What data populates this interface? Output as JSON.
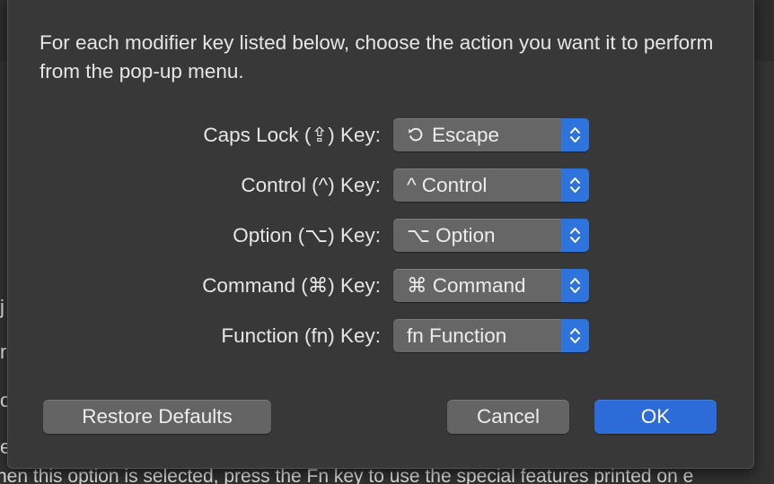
{
  "background": {
    "edge_glyphs": [
      "j",
      "r",
      "o",
      "e"
    ],
    "bottom_text": "hen this option is selected, press the Fn key to use the special features printed on e"
  },
  "dialog": {
    "instruction": "For each modifier key listed below, choose the action you want it to perform from the pop-up menu.",
    "rows": [
      {
        "label": "Caps Lock (⇪) Key:",
        "value": "Escape",
        "value_icon": "escape-icon"
      },
      {
        "label": "Control (^) Key:",
        "value": "^ Control",
        "value_icon": ""
      },
      {
        "label": "Option (⌥) Key:",
        "value": "⌥ Option",
        "value_icon": ""
      },
      {
        "label": "Command (⌘) Key:",
        "value": "⌘ Command",
        "value_icon": ""
      },
      {
        "label": "Function (fn) Key:",
        "value": "fn Function",
        "value_icon": ""
      }
    ],
    "buttons": {
      "restore": "Restore Defaults",
      "cancel": "Cancel",
      "ok": "OK"
    }
  },
  "colors": {
    "accent": "#2d6cd8",
    "sheet_background": "#383838",
    "popup_background": "#666666"
  }
}
